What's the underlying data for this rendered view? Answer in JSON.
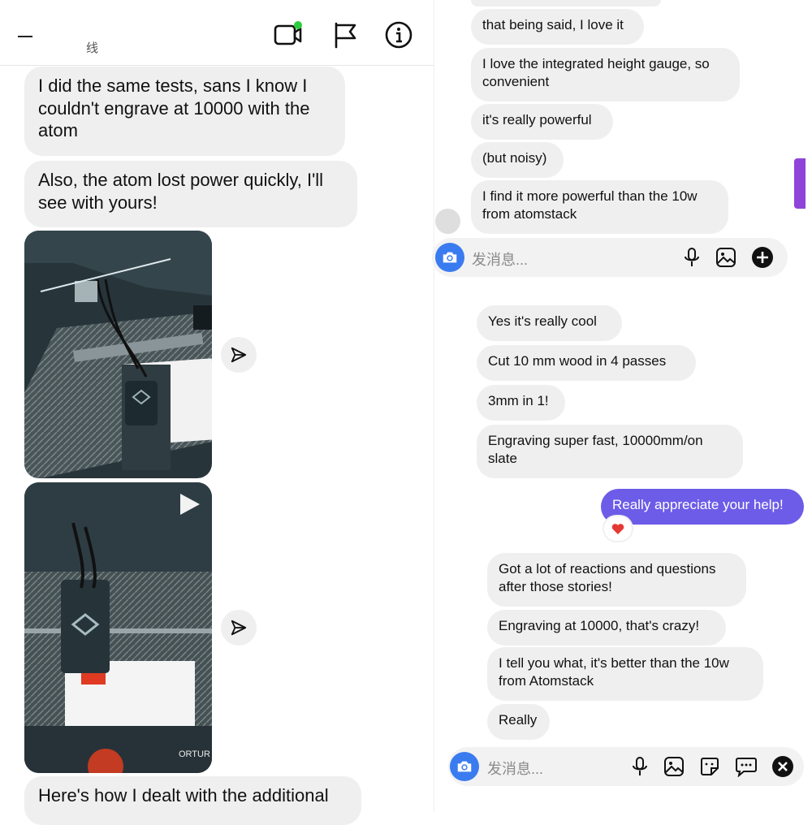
{
  "left_panel": {
    "header": {
      "title_glyph": "线",
      "video_call_icon": "video-call-icon",
      "flag_icon": "flag-icon",
      "info_icon": "info-icon",
      "accent_online": "#2ecc40"
    },
    "messages": [
      {
        "text": "I did the same tests, sans I know I couldn't engrave at 10000 with the atom"
      },
      {
        "text": "Also, the atom lost power quickly, I'll see with yours!"
      },
      {
        "text": "Here's how I dealt with the additional"
      }
    ],
    "media": [
      {
        "type": "photo",
        "icon": "share-icon"
      },
      {
        "type": "video",
        "icon": "play-icon",
        "machine_label": "ORTUR"
      }
    ]
  },
  "right_panel_top": {
    "messages": [
      {
        "text": "that being said, I love it"
      },
      {
        "text": "I love the integrated height gauge, so convenient"
      },
      {
        "text": "it's really powerful"
      },
      {
        "text": "(but noisy)"
      },
      {
        "text": "I find it more powerful than the 10w from atomstack"
      }
    ],
    "composer": {
      "placeholder": "发消息...",
      "icons": [
        "camera-icon",
        "mic-icon",
        "gallery-icon",
        "add-icon"
      ]
    }
  },
  "right_panel_bottom": {
    "messages_in": [
      {
        "text": "Yes it's really cool"
      },
      {
        "text": "Cut 10 mm wood in 4 passes"
      },
      {
        "text": "3mm in 1!"
      },
      {
        "text": "Engraving super fast, 10000mm/on slate"
      }
    ],
    "message_out": {
      "text": "Really appreciate your help!",
      "reaction": "❤️",
      "color": "#6c5ce7"
    },
    "messages_in_2": [
      {
        "text": "Got a lot of reactions and questions after those stories!"
      },
      {
        "text": "Engraving at 10000, that's crazy!"
      },
      {
        "text": "I tell you what, it's better than the 10w from Atomstack"
      },
      {
        "text": "Really"
      }
    ],
    "composer": {
      "placeholder": "发消息...",
      "icons": [
        "camera-icon",
        "mic-icon",
        "gallery-icon",
        "sticker-icon",
        "chat-icon",
        "close-icon"
      ]
    }
  },
  "colors": {
    "bubble_in": "#efefef",
    "bubble_out": "#6c5ce7",
    "camera_blue": "#3a7bf0"
  }
}
